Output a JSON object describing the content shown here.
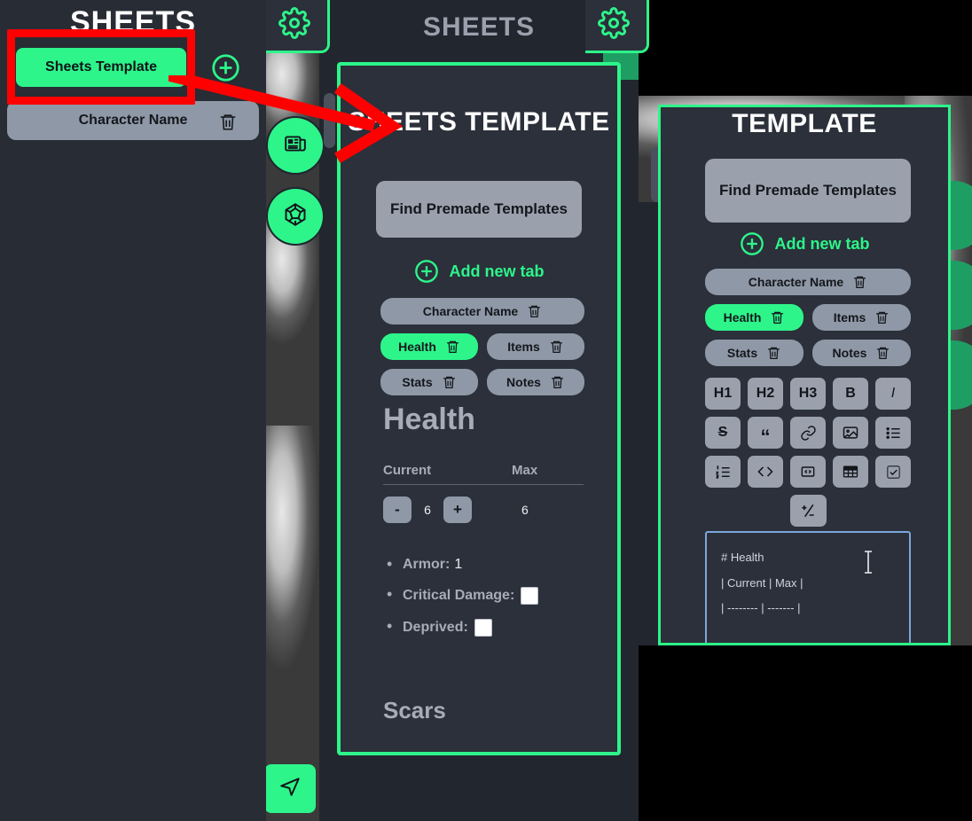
{
  "colors": {
    "accent_green": "#2df58a",
    "panel_bg": "#282c34",
    "card_bg": "#2b303a",
    "pill_gray": "#8f98a6",
    "annotation_red": "#ff0000",
    "editor_border": "#7ba7d9"
  },
  "left_panel": {
    "title": "SHEETS",
    "sheets_template_button": "Sheets Template",
    "add_icon": "plus-circle-icon",
    "character_row": {
      "label": "Character Name",
      "delete_icon": "trash-icon"
    }
  },
  "annotation": {
    "highlight_box": "red-rectangle",
    "arrow": "red-arrow"
  },
  "middle_panel": {
    "header_title": "SHEETS",
    "gear_icon": "gear-icon",
    "sidebar_icons": [
      "newspaper-icon",
      "d20-dice-icon"
    ],
    "drag_handle": "drag-handle",
    "sheet": {
      "title": "SHEETS TEMPLATE",
      "find_templates_button": "Find Premade Templates",
      "add_new_tab": "Add new tab",
      "add_icon": "plus-circle-icon",
      "tabs": [
        {
          "label": "Character Name",
          "active": false,
          "width": "full"
        },
        {
          "label": "Health",
          "active": true,
          "width": "half"
        },
        {
          "label": "Items",
          "active": false,
          "width": "half"
        },
        {
          "label": "Stats",
          "active": false,
          "width": "half"
        },
        {
          "label": "Notes",
          "active": false,
          "width": "half"
        }
      ],
      "section_heading": "Health",
      "table": {
        "columns": [
          "Current",
          "Max"
        ],
        "decrement_label": "-",
        "increment_label": "+",
        "current_value": "6",
        "max_value": "6"
      },
      "bullets": [
        {
          "key": "Armor",
          "value": "1",
          "checkbox": false
        },
        {
          "key": "Critical Damage",
          "value": "",
          "checkbox": true
        },
        {
          "key": "Deprived",
          "value": "",
          "checkbox": true
        }
      ],
      "scars_heading": "Scars"
    },
    "send_icon": "send-icon"
  },
  "right_panel": {
    "title": "TEMPLATE",
    "find_templates_button": "Find Premade Templates",
    "add_new_tab": "Add new tab",
    "add_icon": "plus-circle-icon",
    "gear_icon": "gear-icon",
    "drag_handle": "drag-handle",
    "scrollbar": "vertical-scrollbar",
    "tabs": [
      {
        "label": "Character Name",
        "active": false,
        "width": "full"
      },
      {
        "label": "Health",
        "active": true,
        "width": "half"
      },
      {
        "label": "Items",
        "active": false,
        "width": "half"
      },
      {
        "label": "Stats",
        "active": false,
        "width": "half"
      },
      {
        "label": "Notes",
        "active": false,
        "width": "half"
      }
    ],
    "toolbar": [
      [
        {
          "label": "H1",
          "icon": "heading-1-icon"
        },
        {
          "label": "H2",
          "icon": "heading-2-icon"
        },
        {
          "label": "H3",
          "icon": "heading-3-icon"
        },
        {
          "label": "B",
          "icon": "bold-icon"
        },
        {
          "label": "I",
          "icon": "italic-icon"
        }
      ],
      [
        {
          "label": "S",
          "icon": "strikethrough-icon"
        },
        {
          "label": "“",
          "icon": "blockquote-icon"
        },
        {
          "label": "",
          "icon": "link-icon"
        },
        {
          "label": "",
          "icon": "image-icon"
        },
        {
          "label": "",
          "icon": "bullet-list-icon"
        }
      ],
      [
        {
          "label": "",
          "icon": "numbered-list-icon"
        },
        {
          "label": "",
          "icon": "code-icon"
        },
        {
          "label": "",
          "icon": "inline-code-icon"
        },
        {
          "label": "",
          "icon": "table-icon"
        },
        {
          "label": "",
          "icon": "checkbox-icon"
        }
      ],
      [
        {
          "label": "",
          "icon": "plus-minus-icon"
        }
      ]
    ],
    "editor": {
      "lines": [
        "# Health",
        "",
        "| Current   | Max |",
        "| -------- | ------- |"
      ],
      "cursor_icon": "text-cursor-icon"
    },
    "send_icon": "send-icon"
  }
}
